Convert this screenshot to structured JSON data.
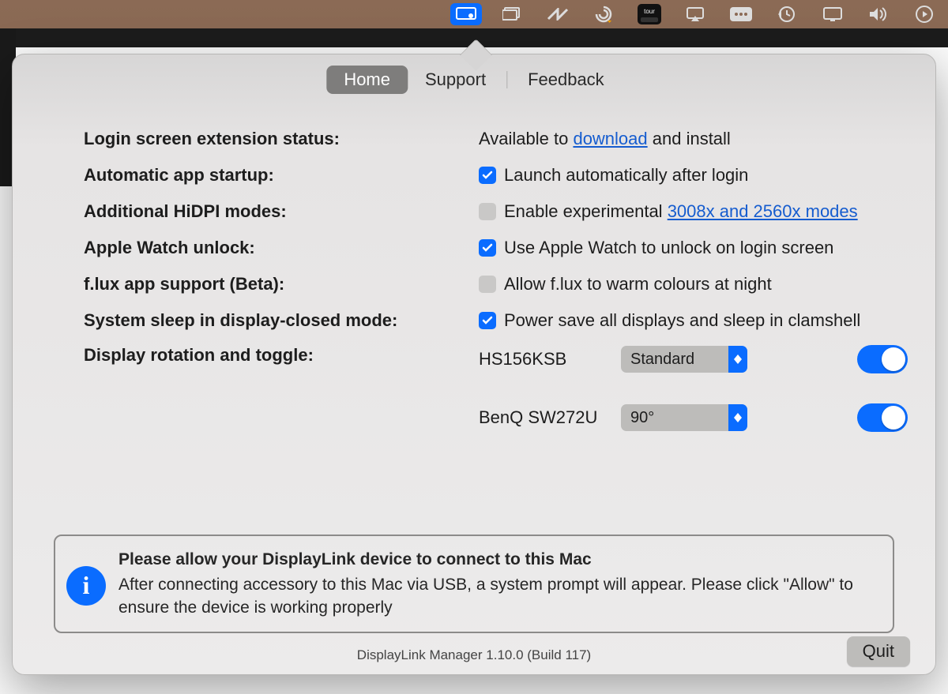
{
  "menubar": {
    "active_icon": "displaylink-menubar-icon"
  },
  "tabs": {
    "home": "Home",
    "support": "Support",
    "feedback": "Feedback"
  },
  "settings": {
    "login_ext_label": "Login screen extension status:",
    "login_ext_prefix": "Available to ",
    "login_ext_link": "download",
    "login_ext_suffix": " and install",
    "auto_startup_label": "Automatic app startup:",
    "auto_startup_text": "Launch automatically after login",
    "auto_startup_checked": true,
    "hidpi_label": "Additional HiDPI modes:",
    "hidpi_text_prefix": "Enable experimental ",
    "hidpi_link": "3008x and 2560x modes",
    "hidpi_checked": false,
    "watch_label": "Apple Watch unlock:",
    "watch_text": "Use Apple Watch to unlock on login screen",
    "watch_checked": true,
    "flux_label": "f.lux app support (Beta):",
    "flux_text": "Allow f.lux to warm colours at night",
    "flux_checked": false,
    "sleep_label": "System sleep in display-closed mode:",
    "sleep_text": "Power save all displays and sleep in clamshell",
    "sleep_checked": true,
    "rotation_label": "Display rotation and toggle:"
  },
  "displays": [
    {
      "name": "HS156KSB",
      "rotation": "Standard",
      "enabled": true
    },
    {
      "name": "BenQ SW272U",
      "rotation": "90°",
      "enabled": true
    }
  ],
  "info": {
    "title": "Please allow your DisplayLink device to connect to this Mac",
    "body": "After connecting accessory to this Mac via USB, a system prompt will appear. Please click \"Allow\" to ensure the device is working properly"
  },
  "footer": {
    "version": "DisplayLink Manager 1.10.0 (Build 117)",
    "quit": "Quit"
  }
}
